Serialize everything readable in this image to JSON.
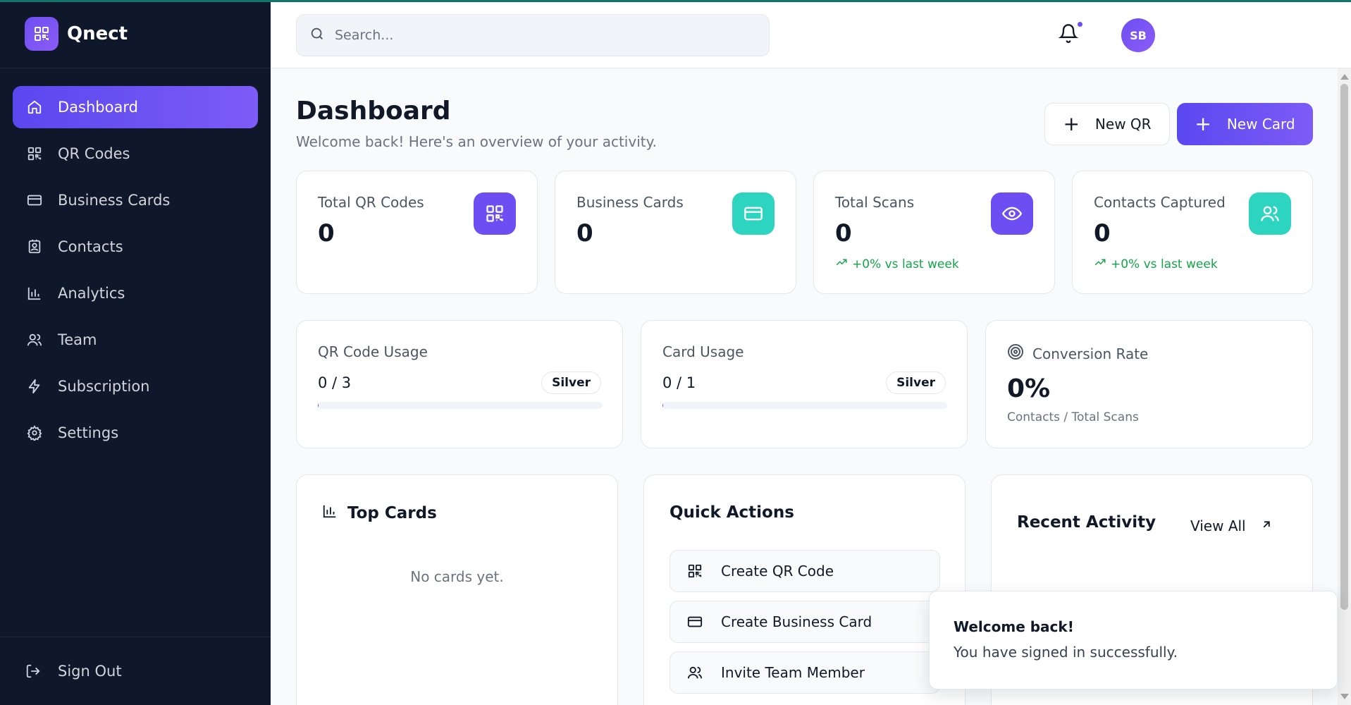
{
  "brand": {
    "name": "Qnect"
  },
  "sidebar": {
    "items": [
      {
        "label": "Dashboard",
        "icon": "home-icon",
        "active": true
      },
      {
        "label": "QR Codes",
        "icon": "qr-code-icon",
        "active": false
      },
      {
        "label": "Business Cards",
        "icon": "credit-card-icon",
        "active": false
      },
      {
        "label": "Contacts",
        "icon": "contact-icon",
        "active": false
      },
      {
        "label": "Analytics",
        "icon": "bar-chart-icon",
        "active": false
      },
      {
        "label": "Team",
        "icon": "users-icon",
        "active": false
      },
      {
        "label": "Subscription",
        "icon": "bolt-icon",
        "active": false
      },
      {
        "label": "Settings",
        "icon": "gear-icon",
        "active": false
      }
    ],
    "sign_out": "Sign Out"
  },
  "header": {
    "search_placeholder": "Search...",
    "avatar_initials": "SB",
    "has_notification": true
  },
  "page": {
    "title": "Dashboard",
    "subtitle": "Welcome back! Here's an overview of your activity.",
    "new_qr_label": "New QR",
    "new_card_label": "New Card"
  },
  "stats": [
    {
      "label": "Total QR Codes",
      "value": "0",
      "icon": "qr-code-icon",
      "color": "#6d4ef2",
      "trend": ""
    },
    {
      "label": "Business Cards",
      "value": "0",
      "icon": "credit-card-icon",
      "color": "#2dd4bf",
      "trend": ""
    },
    {
      "label": "Total Scans",
      "value": "0",
      "icon": "eye-icon",
      "color": "#6d4ef2",
      "trend": "+0% vs last week"
    },
    {
      "label": "Contacts Captured",
      "value": "0",
      "icon": "users-icon",
      "color": "#2dd4bf",
      "trend": "+0% vs last week"
    }
  ],
  "usage": [
    {
      "label": "QR Code Usage",
      "count": "0 / 3",
      "plan": "Silver",
      "progress": 0
    },
    {
      "label": "Card Usage",
      "count": "0 / 1",
      "plan": "Silver",
      "progress": 0
    }
  ],
  "conversion": {
    "label": "Conversion Rate",
    "value": "0%",
    "sub": "Contacts / Total Scans"
  },
  "top_cards": {
    "title": "Top Cards",
    "empty": "No cards yet."
  },
  "quick_actions": {
    "title": "Quick Actions",
    "items": [
      {
        "label": "Create QR Code",
        "icon": "qr-code-icon"
      },
      {
        "label": "Create Business Card",
        "icon": "credit-card-icon"
      },
      {
        "label": "Invite Team Member",
        "icon": "users-icon"
      }
    ]
  },
  "recent_activity": {
    "title": "Recent Activity",
    "view_all": "View All"
  },
  "toast": {
    "title": "Welcome back!",
    "message": "You have signed in successfully."
  },
  "colors": {
    "sidebar_bg": "#0f172a",
    "accent": "#6d4ef2",
    "teal": "#2dd4bf",
    "success": "#16a34a"
  }
}
